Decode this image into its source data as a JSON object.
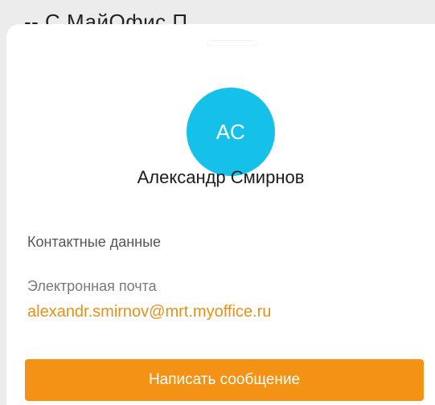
{
  "backdrop": {
    "title_fragment": "--\nС                        МайОфис П"
  },
  "contact": {
    "avatar_initials": "АС",
    "name": "Александр Смирнов",
    "section_title": "Контактные данные",
    "email_label": "Электронная почта",
    "email_value": "alexandr.smirnov@mrt.myoffice.ru"
  },
  "actions": {
    "send_message_label": "Написать сообщение"
  },
  "colors": {
    "avatar": "#16c1e9",
    "accent": "#f39214",
    "link": "#e6901a"
  }
}
